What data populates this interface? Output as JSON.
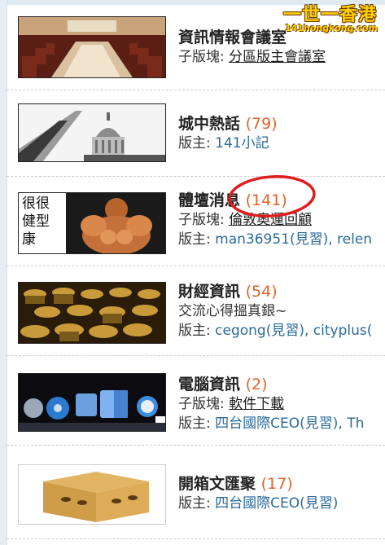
{
  "watermark": {
    "main": "一世一香港",
    "sub": "141hongkong.com"
  },
  "colors": {
    "count": "#e0632a",
    "moderator_link": "#2b6a9a",
    "highlight_circle": "#e01c1c"
  },
  "forums": [
    {
      "image": "conference-room",
      "title": "資訊情報會議室",
      "count": "",
      "lines": [
        {
          "label": "子版塊:",
          "value": "分區版主會議室"
        }
      ]
    },
    {
      "image": "government-building",
      "title": "城中熱話",
      "count": "(79)",
      "lines": [
        {
          "label": "版主:",
          "value": "141小記"
        }
      ]
    },
    {
      "image": "bodybuilder",
      "image_text": [
        "很很",
        "健型",
        "康"
      ],
      "title": "體壇消息",
      "count": "(141)",
      "lines": [
        {
          "label": "子版塊:",
          "value": "倫敦奧運回顧"
        },
        {
          "label": "版主:",
          "value": "man36951(見習), relen"
        }
      ]
    },
    {
      "image": "gold-coins",
      "title": "財經資訊",
      "count": "(54)",
      "lines": [
        {
          "label": "",
          "value": "交流心得搵真銀~"
        },
        {
          "label": "版主:",
          "value": "cegong(見習), cityplus("
        }
      ]
    },
    {
      "image": "mac-dock-icons",
      "title": "電腦資訊",
      "count": "(2)",
      "lines": [
        {
          "label": "子版塊:",
          "value": "軟件下載"
        },
        {
          "label": "版主:",
          "value": "四台國際CEO(見習), Th"
        }
      ]
    },
    {
      "image": "cardboard-box",
      "title": "開箱文匯聚",
      "count": "(17)",
      "lines": [
        {
          "label": "版主:",
          "value": "四台國際CEO(見習)"
        }
      ]
    }
  ]
}
